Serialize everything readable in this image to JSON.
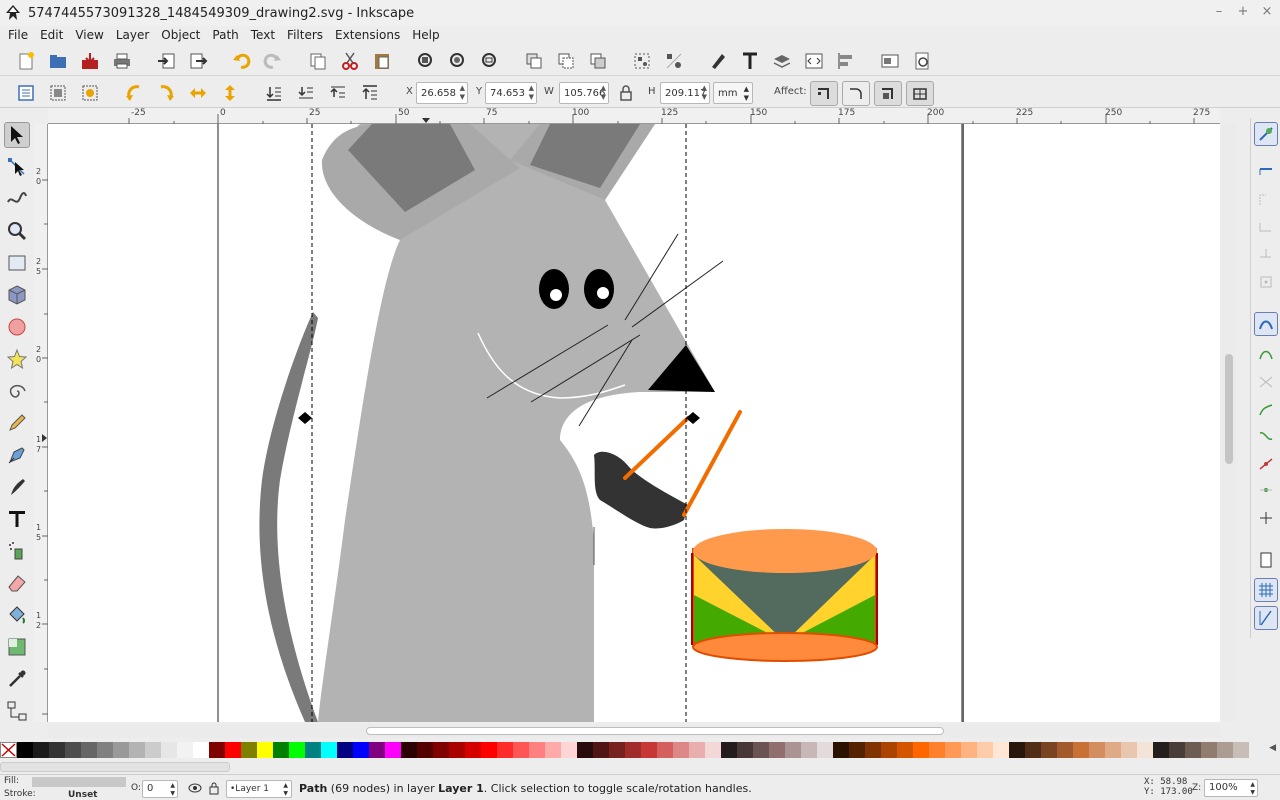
{
  "window": {
    "title": "5747445573091328_1484549309_drawing2.svg - Inkscape",
    "controls": [
      "–",
      "+",
      "×"
    ]
  },
  "menu": [
    "File",
    "Edit",
    "View",
    "Layer",
    "Object",
    "Path",
    "Text",
    "Filters",
    "Extensions",
    "Help"
  ],
  "controls_bar": {
    "x_label": "X",
    "x_value": "26.658",
    "y_label": "Y",
    "y_value": "74.653",
    "w_label": "W",
    "w_value": "105.766",
    "h_label": "H",
    "h_value": "209.117",
    "unit": "mm",
    "affect_label": "Affect:"
  },
  "ruler": {
    "top_ticks": [
      "-25",
      "0",
      "25",
      "50",
      "75",
      "100",
      "125",
      "150",
      "175",
      "200",
      "225",
      "250",
      "275"
    ],
    "left_ticks": [
      "2",
      "0",
      "2",
      "2",
      "5",
      "2",
      "0",
      "1",
      "7",
      "5",
      "1",
      "5",
      "1",
      "2",
      "5"
    ]
  },
  "palette": {
    "colors": [
      "#000000",
      "#1a1a1a",
      "#333333",
      "#4d4d4d",
      "#666666",
      "#808080",
      "#999999",
      "#b3b3b3",
      "#cccccc",
      "#e6e6e6",
      "#f2f2f2",
      "#ffffff",
      "#800000",
      "#ff0000",
      "#808000",
      "#ffff00",
      "#008000",
      "#00ff00",
      "#008080",
      "#00ffff",
      "#000080",
      "#0000ff",
      "#800080",
      "#ff00ff",
      "#2b0000",
      "#550000",
      "#800000",
      "#aa0000",
      "#d40000",
      "#ff0000",
      "#ff2a2a",
      "#ff5555",
      "#ff8080",
      "#ffaaaa",
      "#ffd5d5",
      "#280b0b",
      "#501616",
      "#782121",
      "#a02c2c",
      "#c83737",
      "#d35f5f",
      "#de8787",
      "#e9afaf",
      "#f4d7d7",
      "#241c1c",
      "#483737",
      "#6c5353",
      "#916f6f",
      "#ac9393",
      "#c8b7b7",
      "#e3dbdb",
      "#2b1100",
      "#552200",
      "#803300",
      "#aa4400",
      "#d45500",
      "#ff6600",
      "#ff7f2a",
      "#ff9955",
      "#ffb380",
      "#ffccaa",
      "#ffe6d5",
      "#28170b",
      "#502d16",
      "#784421",
      "#a05a2c",
      "#c87137",
      "#d38d5f",
      "#deaa87",
      "#e9c6af",
      "#f4e3d7",
      "#241f1c",
      "#483e37",
      "#6c5d53",
      "#917c6f",
      "#ac9d93",
      "#c8beb7"
    ]
  },
  "status": {
    "fill_label": "Fill:",
    "stroke_label": "Stroke:",
    "stroke_value": "Unset",
    "opacity_label": "O:",
    "opacity_value": "0",
    "layer_value": "•Layer 1",
    "message_prefix": "Path",
    "message_nodes": " (69 nodes) in layer ",
    "message_layer": "Layer 1",
    "message_suffix": ". Click selection to toggle scale/rotation handles.",
    "x_readout": "X:   58.98",
    "y_readout": "Y:  173.00",
    "zoom_label": "Z:",
    "zoom_value": "100%"
  }
}
